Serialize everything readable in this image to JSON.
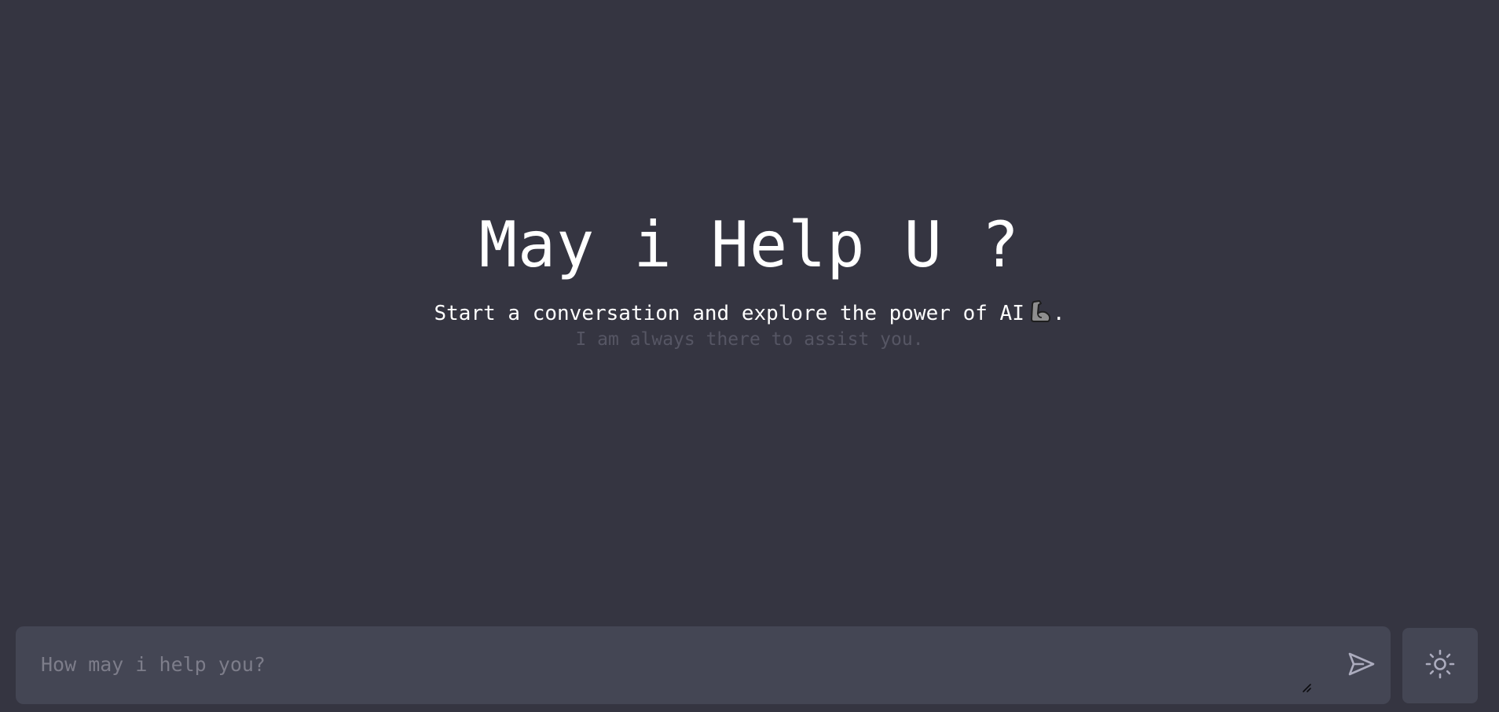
{
  "hero": {
    "title": "May i Help U ?",
    "subtitle": "Start a conversation and explore the power of AI",
    "subtitle_emoji": "flexed-biceps-icon",
    "subtitle_end": ".",
    "hint": "I am always there to assist you."
  },
  "composer": {
    "placeholder": "How may i help you?",
    "value": "",
    "send_icon": "send-icon",
    "resize_icon": "resize-handle-icon"
  },
  "theme_toggle": {
    "icon": "sun-icon"
  },
  "colors": {
    "background": "#353541",
    "panel": "#444654",
    "text": "#ffffff",
    "muted_text": "#565664",
    "placeholder": "#7d7d8a",
    "icon": "#acacbe"
  }
}
